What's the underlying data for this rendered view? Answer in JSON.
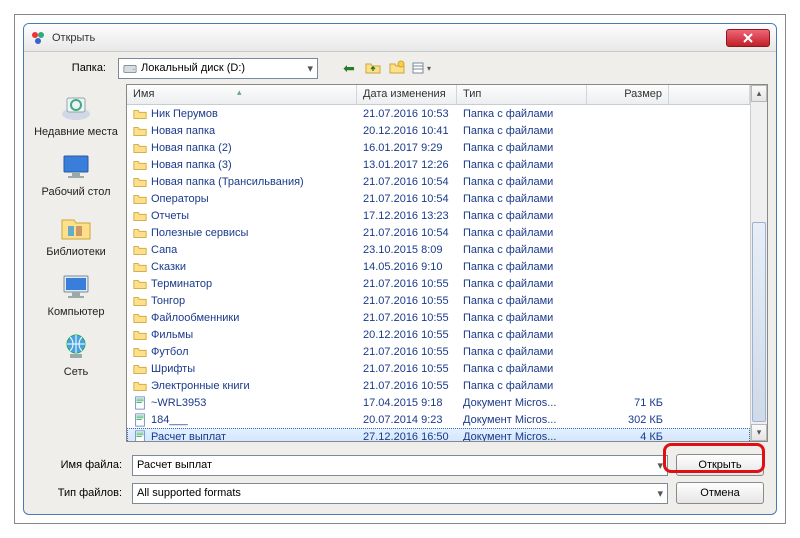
{
  "titlebar": {
    "title": "Открыть"
  },
  "folder_row": {
    "label": "Папка:",
    "selected": "Локальный диск (D:)"
  },
  "places": [
    {
      "label": "Недавние места",
      "icon": "recent"
    },
    {
      "label": "Рабочий стол",
      "icon": "desktop"
    },
    {
      "label": "Библиотеки",
      "icon": "libraries"
    },
    {
      "label": "Компьютер",
      "icon": "computer"
    },
    {
      "label": "Сеть",
      "icon": "network"
    }
  ],
  "columns": {
    "name": "Имя",
    "date": "Дата изменения",
    "type": "Тип",
    "size": "Размер"
  },
  "rows": [
    {
      "name": "Ник Перумов",
      "date": "21.07.2016 10:53",
      "type": "Папка с файлами",
      "size": "",
      "kind": "folder"
    },
    {
      "name": "Новая папка",
      "date": "20.12.2016 10:41",
      "type": "Папка с файлами",
      "size": "",
      "kind": "folder"
    },
    {
      "name": "Новая папка (2)",
      "date": "16.01.2017 9:29",
      "type": "Папка с файлами",
      "size": "",
      "kind": "folder"
    },
    {
      "name": "Новая папка (3)",
      "date": "13.01.2017 12:26",
      "type": "Папка с файлами",
      "size": "",
      "kind": "folder"
    },
    {
      "name": "Новая папка (Трансильвания)",
      "date": "21.07.2016 10:54",
      "type": "Папка с файлами",
      "size": "",
      "kind": "folder"
    },
    {
      "name": "Операторы",
      "date": "21.07.2016 10:54",
      "type": "Папка с файлами",
      "size": "",
      "kind": "folder"
    },
    {
      "name": "Отчеты",
      "date": "17.12.2016 13:23",
      "type": "Папка с файлами",
      "size": "",
      "kind": "folder"
    },
    {
      "name": "Полезные сервисы",
      "date": "21.07.2016 10:54",
      "type": "Папка с файлами",
      "size": "",
      "kind": "folder"
    },
    {
      "name": "Сапа",
      "date": "23.10.2015 8:09",
      "type": "Папка с файлами",
      "size": "",
      "kind": "folder"
    },
    {
      "name": "Сказки",
      "date": "14.05.2016 9:10",
      "type": "Папка с файлами",
      "size": "",
      "kind": "folder"
    },
    {
      "name": "Терминатор",
      "date": "21.07.2016 10:55",
      "type": "Папка с файлами",
      "size": "",
      "kind": "folder"
    },
    {
      "name": "Тонгор",
      "date": "21.07.2016 10:55",
      "type": "Папка с файлами",
      "size": "",
      "kind": "folder"
    },
    {
      "name": "Файлообменники",
      "date": "21.07.2016 10:55",
      "type": "Папка с файлами",
      "size": "",
      "kind": "folder"
    },
    {
      "name": "Фильмы",
      "date": "20.12.2016 10:55",
      "type": "Папка с файлами",
      "size": "",
      "kind": "folder"
    },
    {
      "name": "Футбол",
      "date": "21.07.2016 10:55",
      "type": "Папка с файлами",
      "size": "",
      "kind": "folder"
    },
    {
      "name": "Шрифты",
      "date": "21.07.2016 10:55",
      "type": "Папка с файлами",
      "size": "",
      "kind": "folder"
    },
    {
      "name": "Электронные книги",
      "date": "21.07.2016 10:55",
      "type": "Папка с файлами",
      "size": "",
      "kind": "folder"
    },
    {
      "name": "~WRL3953",
      "date": "17.04.2015 9:18",
      "type": "Документ Micros...",
      "size": "71 КБ",
      "kind": "doc"
    },
    {
      "name": "184___",
      "date": "20.07.2014 9:23",
      "type": "Документ Micros...",
      "size": "302 КБ",
      "kind": "doc"
    },
    {
      "name": "Расчет выплат",
      "date": "27.12.2016 16:50",
      "type": "Документ Micros...",
      "size": "4 КБ",
      "kind": "doc",
      "selected": true
    }
  ],
  "bottom": {
    "filename_label": "Имя файла:",
    "filename_value": "Расчет выплат",
    "filetype_label": "Тип файлов:",
    "filetype_value": "All supported formats",
    "open_button": "Открыть",
    "cancel_button": "Отмена"
  }
}
